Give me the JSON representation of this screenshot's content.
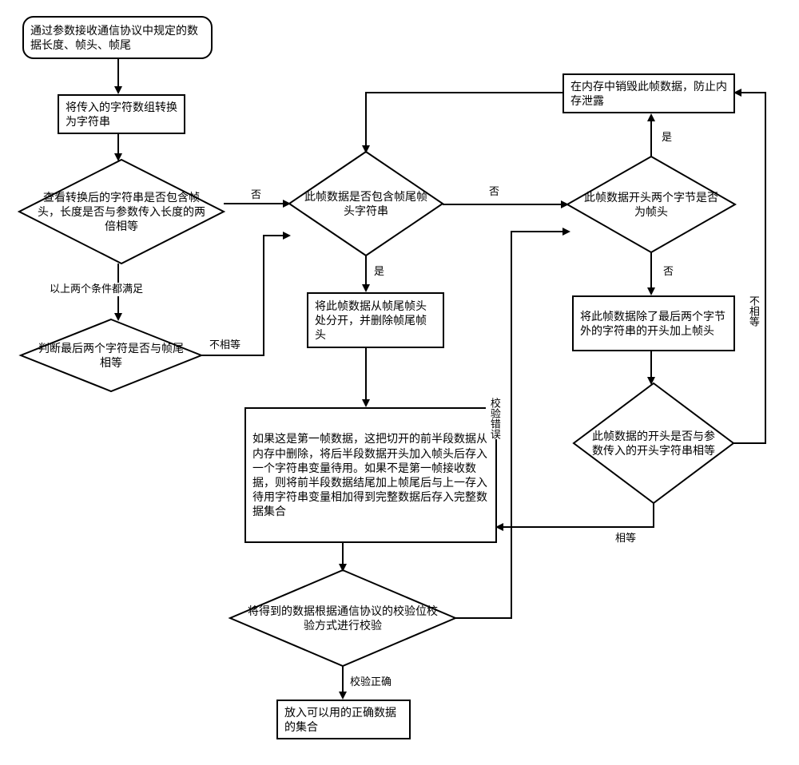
{
  "nodes": {
    "start": "通过参数接收通信协议中规定的数据长度、帧头、帧尾",
    "toString": "将传入的字符数组转换为字符串",
    "checkHeaderLen": "查看转换后的字符串是否包含帧头，长度是否与参数传入长度的两倍相等",
    "checkTailEqual": "判断最后两个字符是否与帧尾相等",
    "containsTailHead": "此帧数据是否包含帧尾帧头字符串",
    "splitAtTailHead": "将此帧数据从帧尾帧头处分开，并删除帧尾帧头",
    "longProcess": "如果这是第一帧数据，这把切开的前半段数据从内存中删除，将后半段数据开头加入帧头后存入一个字符串变量待用。如果不是第一帧接收数据，则将前半段数据结尾加上帧尾后与上一存入待用字符串变量相加得到完整数据后存入完整数据集合",
    "verify": "将得到的数据根据通信协议的校验位校验方式进行校验",
    "putCorrect": "放入可以用的正确数据的集合",
    "destroy": "在内存中销毁此帧数据，防止内存泄露",
    "firstTwoHead": "此帧数据开头两个字节是否为帧头",
    "addHead": "将此帧数据除了最后两个字节外的字符串的开头加上帧头",
    "startEqualParam": "此帧数据的开头是否与参数传入的开头字符串相等"
  },
  "labels": {
    "no": "否",
    "yes": "是",
    "bothSatisfied": "以上两个条件都满足",
    "notEqual": "不相等",
    "verifyError": "校验错误",
    "verifyCorrect": "校验正确",
    "equal": "相等"
  }
}
